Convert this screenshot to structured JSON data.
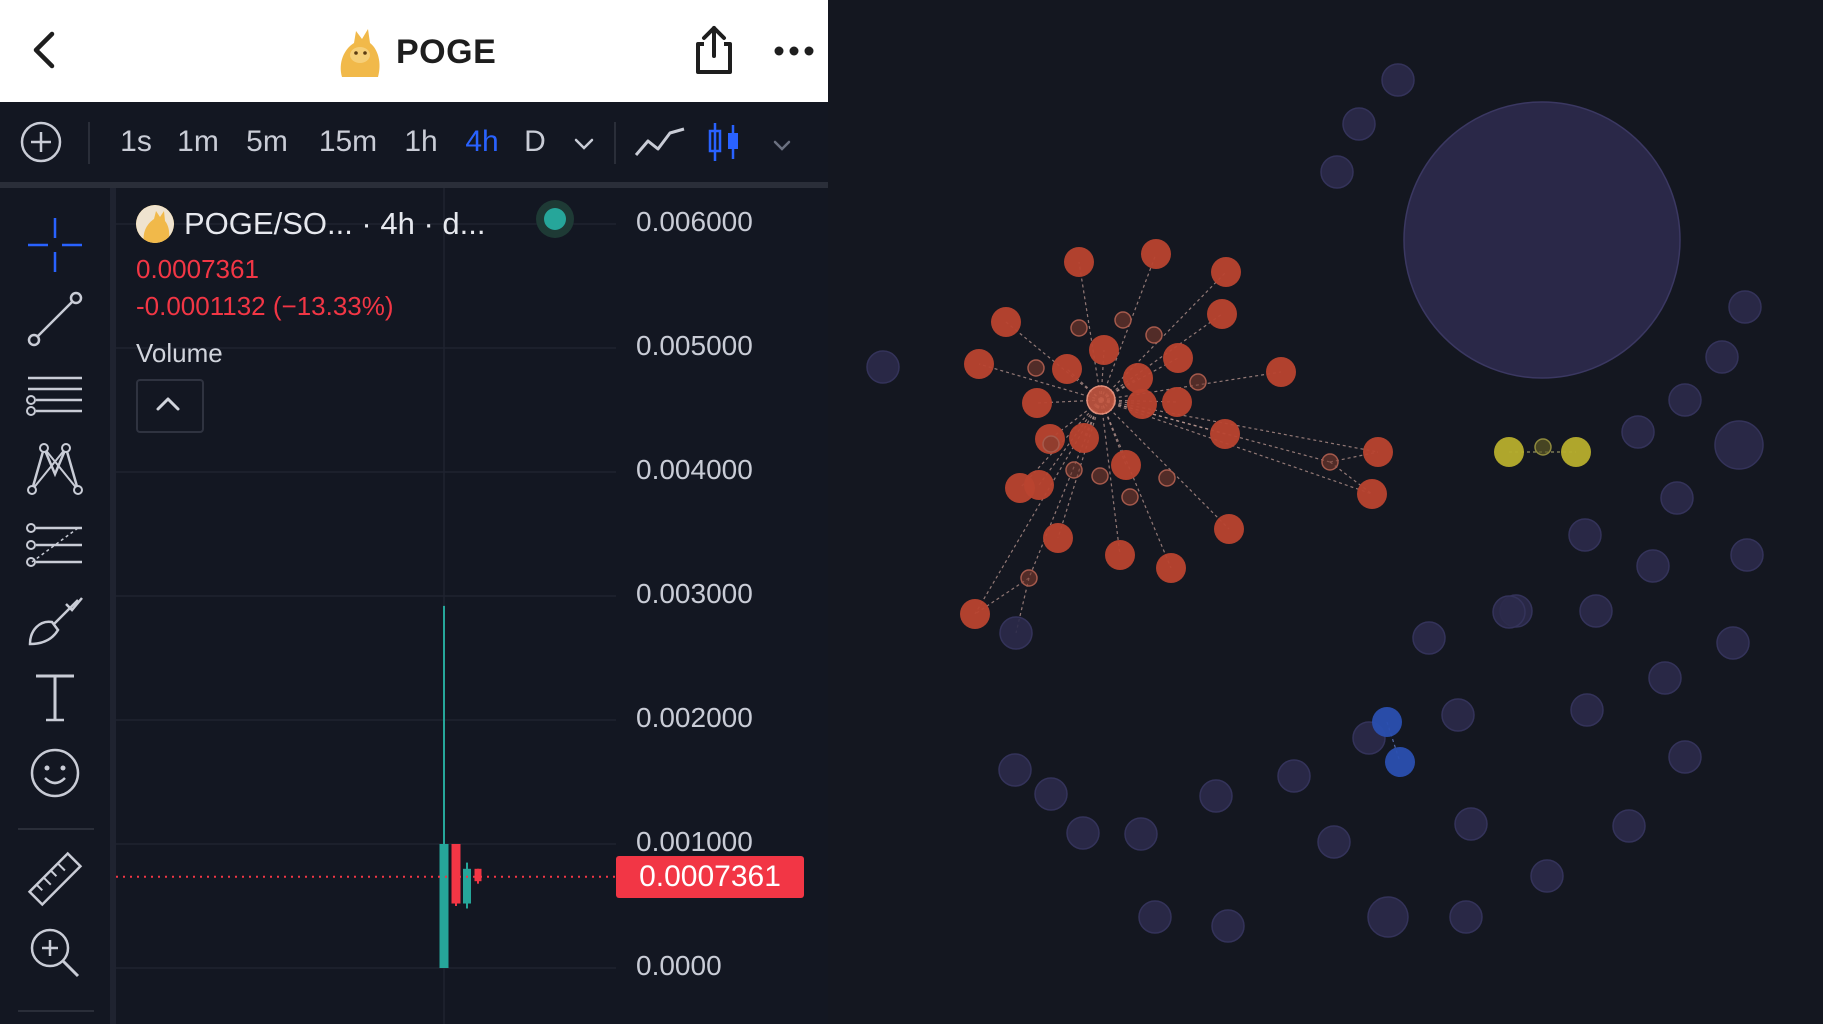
{
  "header": {
    "title": "POGE",
    "back_icon": "chevron-left-icon",
    "share_icon": "share-icon",
    "more_icon": "more-horizontal-icon"
  },
  "toolbar": {
    "intervals": [
      "1s",
      "1m",
      "5m",
      "15m",
      "1h",
      "4h",
      "D"
    ],
    "active_interval": "4h",
    "accent_color": "#2962ff"
  },
  "drawing_tools": [
    "crosshair-icon",
    "trend-line-icon",
    "horizontal-lines-icon",
    "pattern-icon",
    "fib-icon",
    "brush-icon",
    "text-icon",
    "emoji-icon",
    "ruler-icon",
    "zoom-in-icon"
  ],
  "legend": {
    "symbol": "POGE/SO... · 4h · d...",
    "price": "0.0007361",
    "change": "-0.0001132 (−13.33%)",
    "volume_label": "Volume",
    "up_color": "#26a69a",
    "down_color": "#f23645"
  },
  "chart_data": {
    "type": "candlestick",
    "y_ticks": [
      "0.006000",
      "0.005000",
      "0.004000",
      "0.003000",
      "0.002000",
      "0.001000",
      "0.0000"
    ],
    "ylim": [
      0,
      0.0063
    ],
    "last_price": "0.0007361",
    "candles": [
      {
        "open": 0.0,
        "high": 0.00292,
        "low": 0.0,
        "close": 0.001,
        "color": "up"
      },
      {
        "open": 0.001,
        "high": 0.001,
        "low": 0.0005,
        "close": 0.00052,
        "color": "down"
      },
      {
        "open": 0.00052,
        "high": 0.00085,
        "low": 0.00048,
        "close": 0.0008,
        "color": "up"
      },
      {
        "open": 0.0008,
        "high": 0.0008,
        "low": 0.00068,
        "close": 0.0007,
        "color": "down"
      }
    ]
  },
  "bubble_map": {
    "colors": {
      "background": "#141720",
      "neutral_bubble": "#2b2a4a",
      "cluster_red": "#b9432f",
      "cluster_yellow": "#b7ae2d",
      "cluster_blue": "#2a4fb0"
    }
  }
}
